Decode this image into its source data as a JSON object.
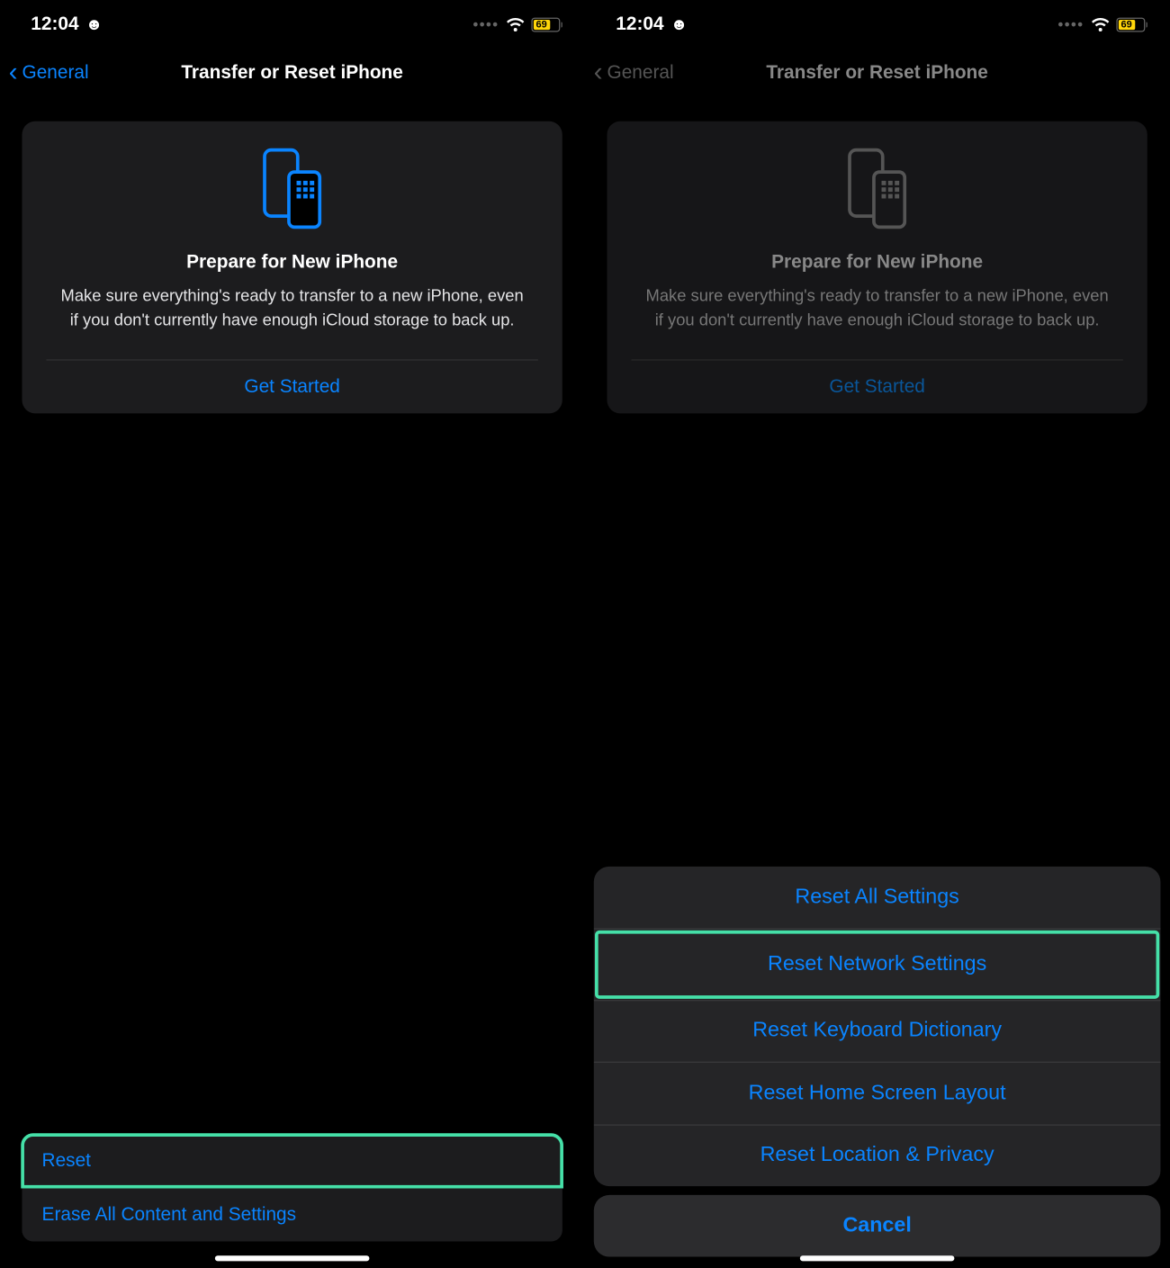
{
  "status": {
    "time": "12:04",
    "face_emoji": "☻",
    "battery_percent": "69"
  },
  "nav": {
    "back_label": "General",
    "title": "Transfer or Reset iPhone"
  },
  "card": {
    "title": "Prepare for New iPhone",
    "description": "Make sure everything's ready to transfer to a new iPhone, even if you don't currently have enough iCloud storage to back up.",
    "action": "Get Started"
  },
  "left_options": {
    "reset": "Reset",
    "erase": "Erase All Content and Settings"
  },
  "sheet": {
    "items": [
      "Reset All Settings",
      "Reset Network Settings",
      "Reset Keyboard Dictionary",
      "Reset Home Screen Layout",
      "Reset Location & Privacy"
    ],
    "cancel": "Cancel"
  },
  "colors": {
    "accent": "#0a84ff",
    "highlight": "#45e0a8",
    "battery_fill": "#ffd60a"
  }
}
